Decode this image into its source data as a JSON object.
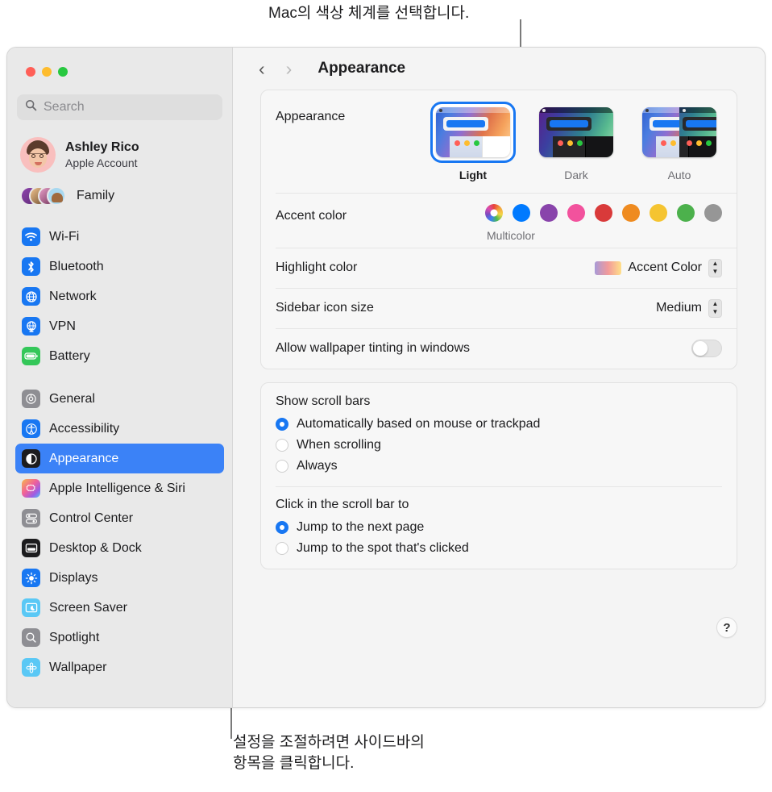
{
  "callouts": {
    "top": "Mac의 색상 체계를 선택합니다.",
    "bottom": "설정을 조절하려면 사이드바의\n항목을 클릭합니다."
  },
  "window": {
    "traffic_lights": [
      "close",
      "minimize",
      "zoom"
    ]
  },
  "sidebar": {
    "search": {
      "placeholder": "Search",
      "value": ""
    },
    "account": {
      "name": "Ashley Rico",
      "subtitle": "Apple Account"
    },
    "family": {
      "label": "Family"
    },
    "groups": [
      {
        "items": [
          {
            "label": "Wi-Fi",
            "icon": "wifi-icon",
            "color": "#1877f2",
            "selected": false
          },
          {
            "label": "Bluetooth",
            "icon": "bluetooth-icon",
            "color": "#1877f2",
            "selected": false
          },
          {
            "label": "Network",
            "icon": "globe-icon",
            "color": "#1877f2",
            "selected": false
          },
          {
            "label": "VPN",
            "icon": "vpn-globe-icon",
            "color": "#1877f2",
            "selected": false
          },
          {
            "label": "Battery",
            "icon": "battery-icon",
            "color": "#34c759",
            "selected": false
          }
        ]
      },
      {
        "items": [
          {
            "label": "General",
            "icon": "gear-icon",
            "color": "#8e8e93",
            "selected": false
          },
          {
            "label": "Accessibility",
            "icon": "accessibility-icon",
            "color": "#1877f2",
            "selected": false
          },
          {
            "label": "Appearance",
            "icon": "appearance-contrast-icon",
            "color": "#1c1c1e",
            "selected": true
          },
          {
            "label": "Apple Intelligence & Siri",
            "icon": "siri-icon",
            "color": "#f05fa0",
            "selected": false
          },
          {
            "label": "Control Center",
            "icon": "control-center-icon",
            "color": "#8e8e93",
            "selected": false
          },
          {
            "label": "Desktop & Dock",
            "icon": "desktop-dock-icon",
            "color": "#1c1c1e",
            "selected": false
          },
          {
            "label": "Displays",
            "icon": "brightness-icon",
            "color": "#1877f2",
            "selected": false
          },
          {
            "label": "Screen Saver",
            "icon": "screen-saver-icon",
            "color": "#5ac8f5",
            "selected": false
          },
          {
            "label": "Spotlight",
            "icon": "search-icon",
            "color": "#8e8e93",
            "selected": false
          },
          {
            "label": "Wallpaper",
            "icon": "wallpaper-flower-icon",
            "color": "#5ac8f5",
            "selected": false
          }
        ]
      }
    ]
  },
  "toolbar": {
    "back_icon": "chevron-left-icon",
    "forward_icon": "chevron-right-icon",
    "title": "Appearance"
  },
  "main": {
    "appearance": {
      "label": "Appearance",
      "options": [
        {
          "label": "Light",
          "selected": true
        },
        {
          "label": "Dark",
          "selected": false
        },
        {
          "label": "Auto",
          "selected": false
        }
      ]
    },
    "accent_color": {
      "label": "Accent color",
      "caption": "Multicolor",
      "swatches": [
        {
          "name": "Multicolor",
          "color": "multicolor",
          "selected": true
        },
        {
          "name": "Blue",
          "color": "#007aff",
          "selected": false
        },
        {
          "name": "Purple",
          "color": "#8944ab",
          "selected": false
        },
        {
          "name": "Pink",
          "color": "#f2529d",
          "selected": false
        },
        {
          "name": "Red",
          "color": "#d93a3a",
          "selected": false
        },
        {
          "name": "Orange",
          "color": "#ef8b20",
          "selected": false
        },
        {
          "name": "Yellow",
          "color": "#f5c431",
          "selected": false
        },
        {
          "name": "Green",
          "color": "#4cb14c",
          "selected": false
        },
        {
          "name": "Graphite",
          "color": "#969696",
          "selected": false
        }
      ]
    },
    "highlight_color": {
      "label": "Highlight color",
      "value": "Accent Color"
    },
    "sidebar_icon_size": {
      "label": "Sidebar icon size",
      "value": "Medium"
    },
    "wallpaper_tinting": {
      "label": "Allow wallpaper tinting in windows",
      "enabled": false
    },
    "scroll_bars": {
      "label": "Show scroll bars",
      "options": [
        {
          "label": "Automatically based on mouse or trackpad",
          "selected": true
        },
        {
          "label": "When scrolling",
          "selected": false
        },
        {
          "label": "Always",
          "selected": false
        }
      ]
    },
    "scroll_click": {
      "label": "Click in the scroll bar to",
      "options": [
        {
          "label": "Jump to the next page",
          "selected": true
        },
        {
          "label": "Jump to the spot that's clicked",
          "selected": false
        }
      ]
    },
    "help_button": "?"
  }
}
